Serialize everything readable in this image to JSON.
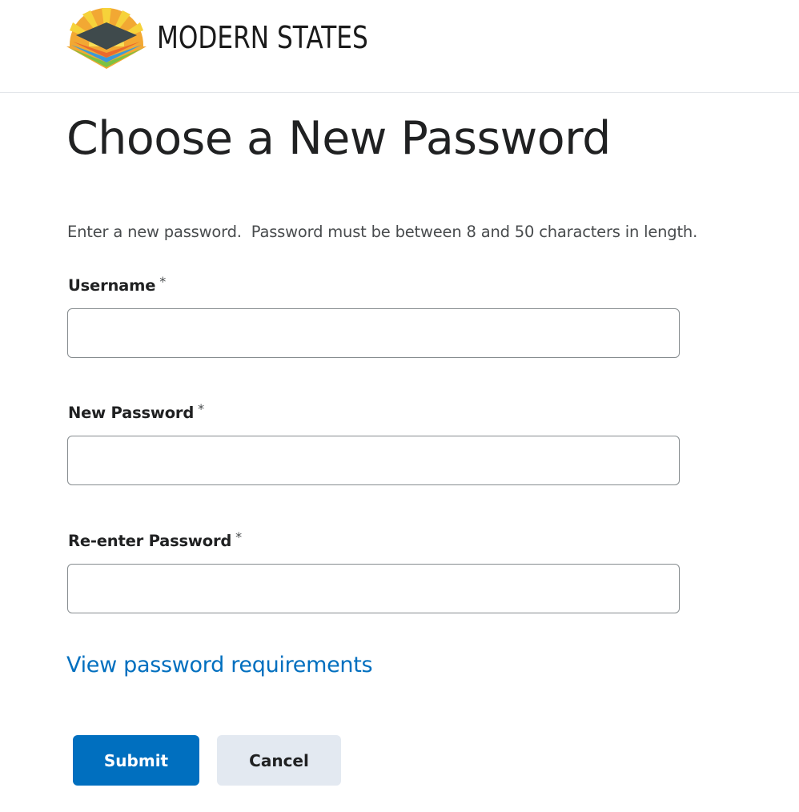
{
  "brand": {
    "name": "MODERN STATES",
    "colors": {
      "sun_yellow": "#f6d23a",
      "sun_orange": "#f2a833",
      "stack_dark": "#3f4a4c",
      "stack_orange": "#ea6a2e",
      "stack_blue": "#3a9ad9",
      "stack_green": "#7cc242"
    }
  },
  "page": {
    "title": "Choose a New Password",
    "intro": "Enter a new password.  Password must be between 8 and 50 characters in length."
  },
  "form": {
    "required_marker": "*",
    "username": {
      "label": "Username",
      "value": "",
      "placeholder": ""
    },
    "new_password": {
      "label": "New Password",
      "value": "",
      "placeholder": ""
    },
    "reenter_password": {
      "label": "Re-enter Password",
      "value": "",
      "placeholder": ""
    },
    "requirements_link": "View password requirements",
    "submit_label": "Submit",
    "cancel_label": "Cancel"
  },
  "colors": {
    "primary": "#006fbf",
    "secondary_button": "#e3e9f1",
    "input_border": "#868c8f",
    "text": "#202122"
  }
}
